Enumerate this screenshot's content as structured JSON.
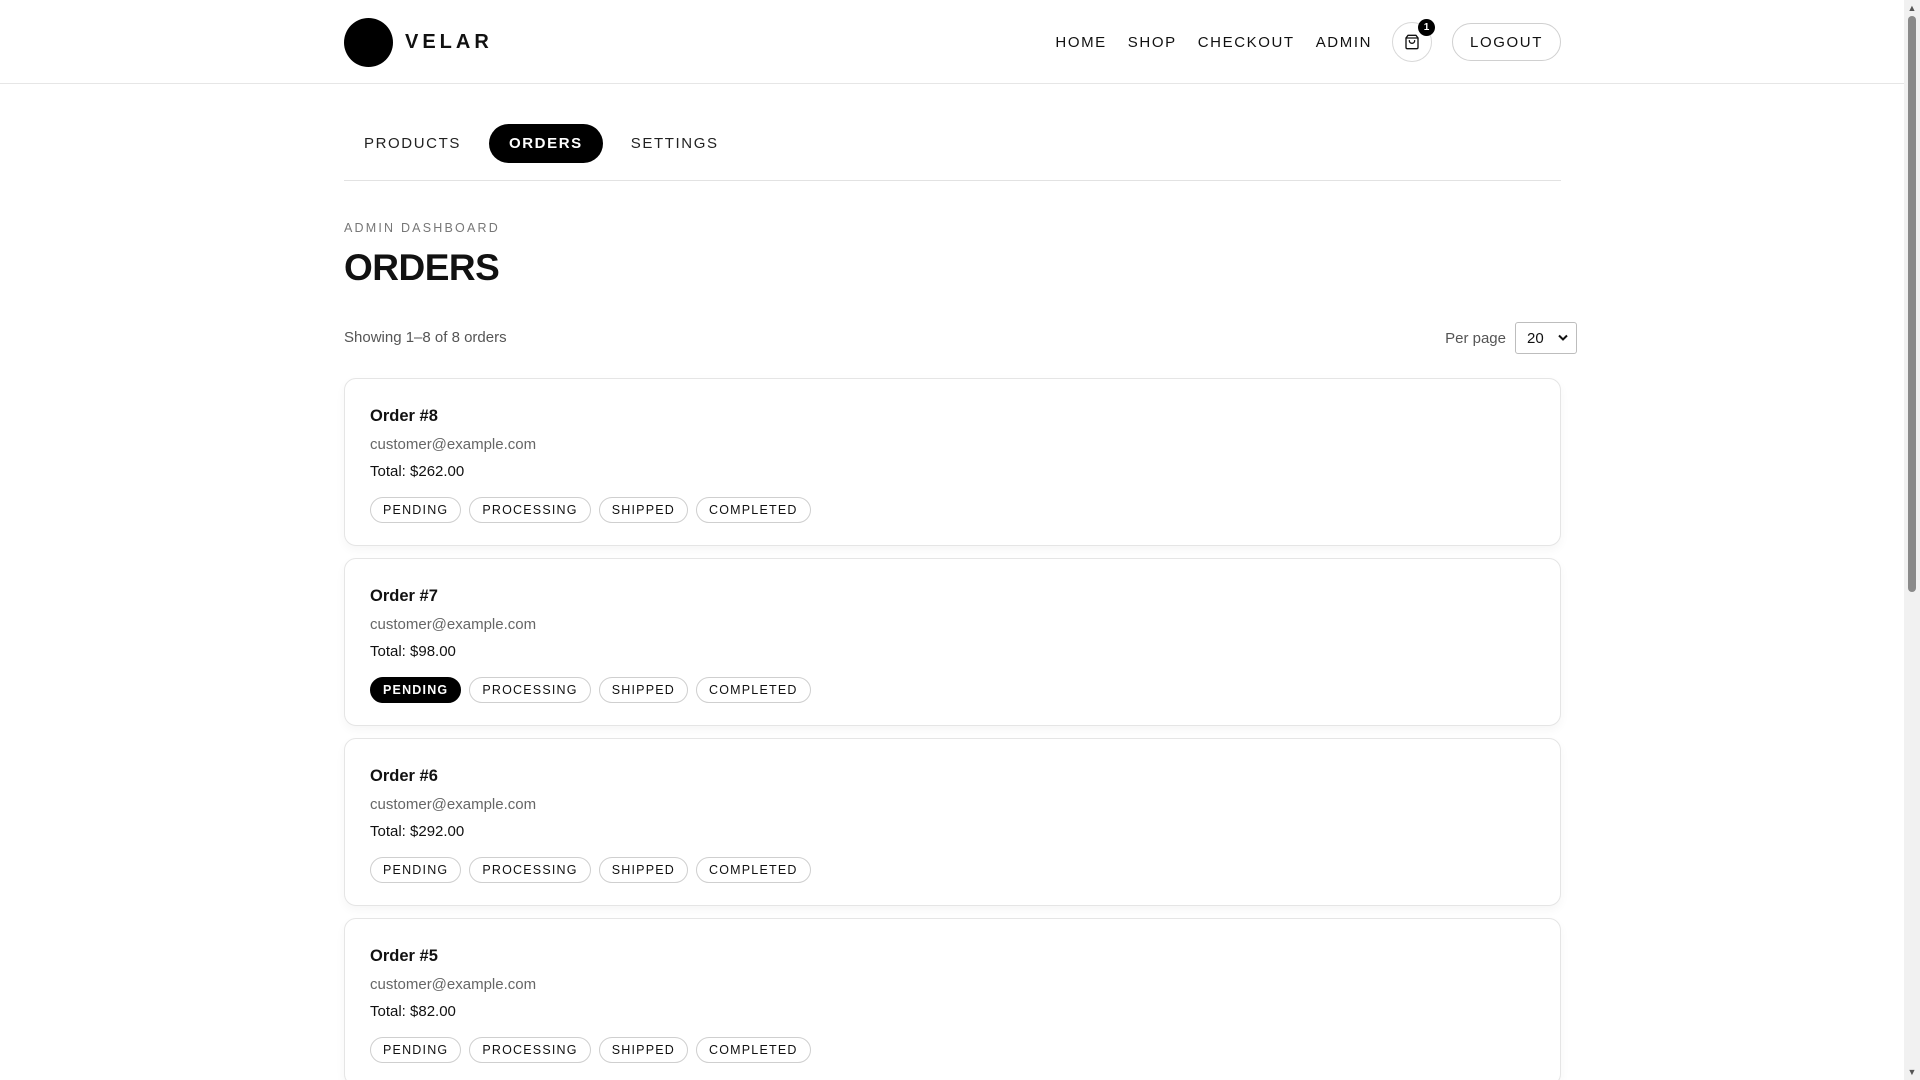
{
  "brand": {
    "name": "VELAR"
  },
  "nav": {
    "links": [
      "HOME",
      "SHOP",
      "CHECKOUT",
      "ADMIN"
    ],
    "cart_count": "1",
    "cart_icon": "shopping-bag-icon",
    "logout_label": "LOGOUT"
  },
  "tabs": [
    {
      "label": "PRODUCTS",
      "active": false
    },
    {
      "label": "ORDERS",
      "active": true
    },
    {
      "label": "SETTINGS",
      "active": false
    }
  ],
  "page": {
    "eyebrow": "ADMIN DASHBOARD",
    "title": "ORDERS",
    "showing": "Showing 1–8 of 8 orders",
    "per_page_label": "Per page",
    "per_page_value": "20"
  },
  "status_options": [
    "PENDING",
    "PROCESSING",
    "SHIPPED",
    "COMPLETED"
  ],
  "orders": [
    {
      "title": "Order #8",
      "email": "customer@example.com",
      "total": "Total: $262.00",
      "active_status": ""
    },
    {
      "title": "Order #7",
      "email": "customer@example.com",
      "total": "Total: $98.00",
      "active_status": "PENDING"
    },
    {
      "title": "Order #6",
      "email": "customer@example.com",
      "total": "Total: $292.00",
      "active_status": ""
    },
    {
      "title": "Order #5",
      "email": "customer@example.com",
      "total": "Total: $82.00",
      "active_status": ""
    }
  ],
  "colors": {
    "accent": "#000000",
    "border": "#e5e5e5",
    "muted_text": "#666666"
  }
}
